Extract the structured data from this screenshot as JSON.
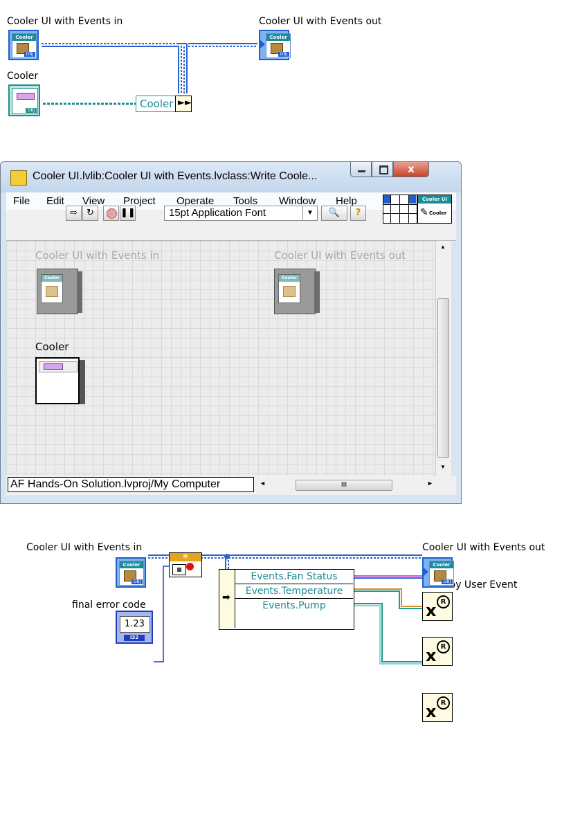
{
  "top_diagram": {
    "label_in": "Cooler UI with Events in",
    "label_out": "Cooler UI with Events out",
    "label_cooler": "Cooler",
    "bundle_field": "Cooler",
    "class_header": "Cooler UI",
    "class_tag": "DBJ"
  },
  "window": {
    "title": "Cooler UI.lvlib:Cooler UI with Events.lvclass:Write Coole...",
    "menu": [
      "File",
      "Edit",
      "View",
      "Project",
      "Operate",
      "Tools",
      "Window",
      "Help"
    ],
    "font_selector": "15pt Application Font",
    "icon_text_top": "Cooler UI",
    "icon_text_bottom": "Cooler",
    "front_panel": {
      "label_in": "Cooler UI with Events in",
      "label_out": "Cooler UI with Events out",
      "label_cooler": "Cooler",
      "class_header": "Cooler UI"
    },
    "status": "AF Hands-On Solution.lvproj/My Computer",
    "hscroll_grip": "III"
  },
  "bottom_diagram": {
    "label_in": "Cooler UI with Events in",
    "label_out": "Cooler UI with Events out",
    "label_error": "final error code",
    "error_value": "1.23",
    "error_type": "I32",
    "destroy_label": "Destroy User Event",
    "unbundle_fields": [
      "Events.Fan Status",
      "Events.Temperature",
      "Events.Pump"
    ],
    "class_header": "Cooler UI",
    "class_tag": "DBJ"
  },
  "colors": {
    "class_wire": "#2a62cf",
    "cooler_wire": "#1d8f8a",
    "fan_wire": "#d24fd6",
    "temp_wire": "#e08a2a",
    "pump_wire": "#1f9a8e"
  }
}
